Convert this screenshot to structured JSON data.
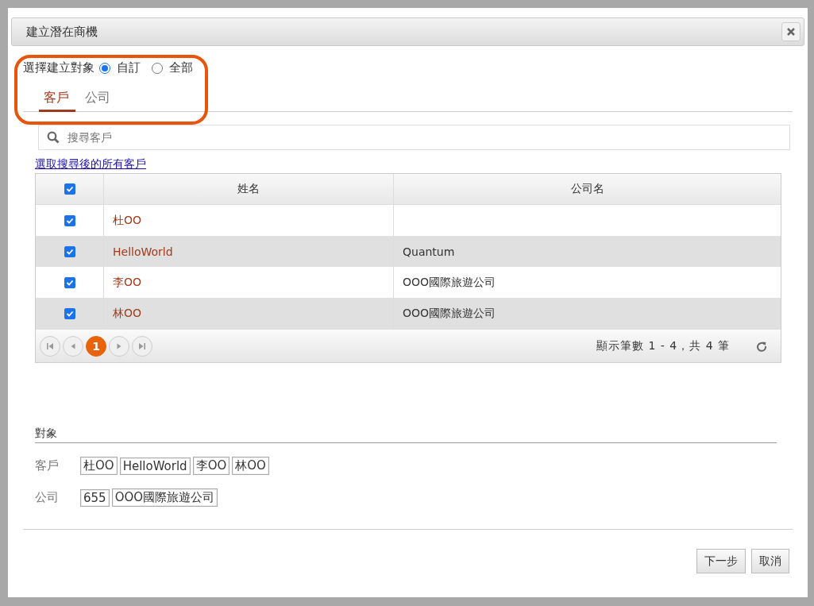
{
  "dialog": {
    "title": "建立潛在商機"
  },
  "target_selector": {
    "label": "選擇建立對象",
    "options": [
      {
        "label": "自訂",
        "selected": true
      },
      {
        "label": "全部",
        "selected": false
      }
    ]
  },
  "tabs": [
    {
      "label": "客戶",
      "selected": true
    },
    {
      "label": "公司",
      "selected": false
    }
  ],
  "search": {
    "placeholder": "搜尋客戶"
  },
  "select_all_link": "選取搜尋後的所有客戶",
  "table": {
    "header_checked": true,
    "columns": [
      "姓名",
      "公司名"
    ],
    "rows": [
      {
        "checked": true,
        "name": "杜OO"
      },
      {
        "checked": true,
        "name": "HelloWorld",
        "company": "Quantum"
      },
      {
        "checked": true,
        "name": "李OO",
        "company": "OOO國際旅遊公司"
      },
      {
        "checked": true,
        "name": "林OO",
        "company": "OOO國際旅遊公司"
      }
    ]
  },
  "pager": {
    "pages": [
      {
        "label": "1",
        "selected": true
      }
    ],
    "summary": "顯示筆數 1 - 4，共 4 筆"
  },
  "targets": {
    "heading": "對象",
    "groups": [
      {
        "label": "客戶",
        "tags": [
          "杜OO",
          "HelloWorld",
          "李OO",
          "林OO"
        ]
      },
      {
        "label": "公司",
        "tags": [
          "655",
          "OOO國際旅遊公司"
        ]
      }
    ]
  },
  "buttons": [
    "下一步",
    "取消"
  ]
}
